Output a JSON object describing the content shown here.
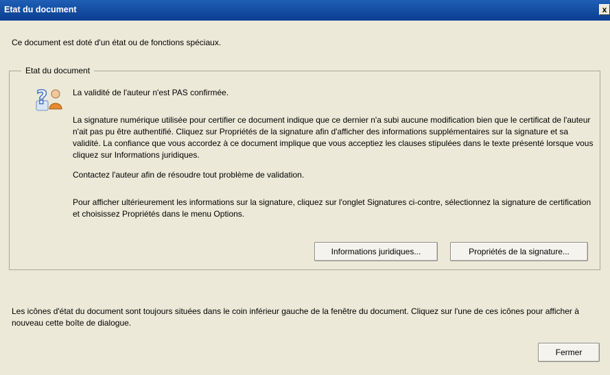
{
  "window": {
    "title": "Etat du document",
    "close_glyph": "x"
  },
  "intro_text": "Ce document est doté d'un état ou de fonctions spéciaux.",
  "group": {
    "legend": "Etat du document",
    "icon": "help-user-icon",
    "status": "La validité de l'auteur n'est PAS confirmée.",
    "description": "La signature numérique utilisée pour certifier ce document indique que ce dernier n'a subi aucune modification bien que le certificat de l'auteur n'ait pas pu être authentifié. Cliquez sur Propriétés de la signature afin d'afficher des informations supplémentaires sur la signature et sa validité. La confiance que vous accordez à ce document implique que vous acceptiez les clauses stipulées dans le texte présenté lorsque vous cliquez sur Informations juridiques.",
    "contact": "Contactez l'auteur afin de résoudre tout problème de validation.",
    "instructions": "Pour afficher ultérieurement les informations sur la signature, cliquez sur l'onglet Signatures ci-contre, sélectionnez la signature de certification et choisissez Propriétés dans le menu Options.",
    "legal_button": "Informations juridiques...",
    "properties_button": "Propriétés de la signature..."
  },
  "footer_text": "Les icônes d'état du document sont toujours situées dans le coin inférieur gauche de la fenêtre du document. Cliquez sur l'une de ces icônes pour afficher à nouveau cette boîte de dialogue.",
  "close_button": "Fermer",
  "colors": {
    "titlebar": "#0a3d91",
    "dialog_bg": "#ece9d8"
  }
}
